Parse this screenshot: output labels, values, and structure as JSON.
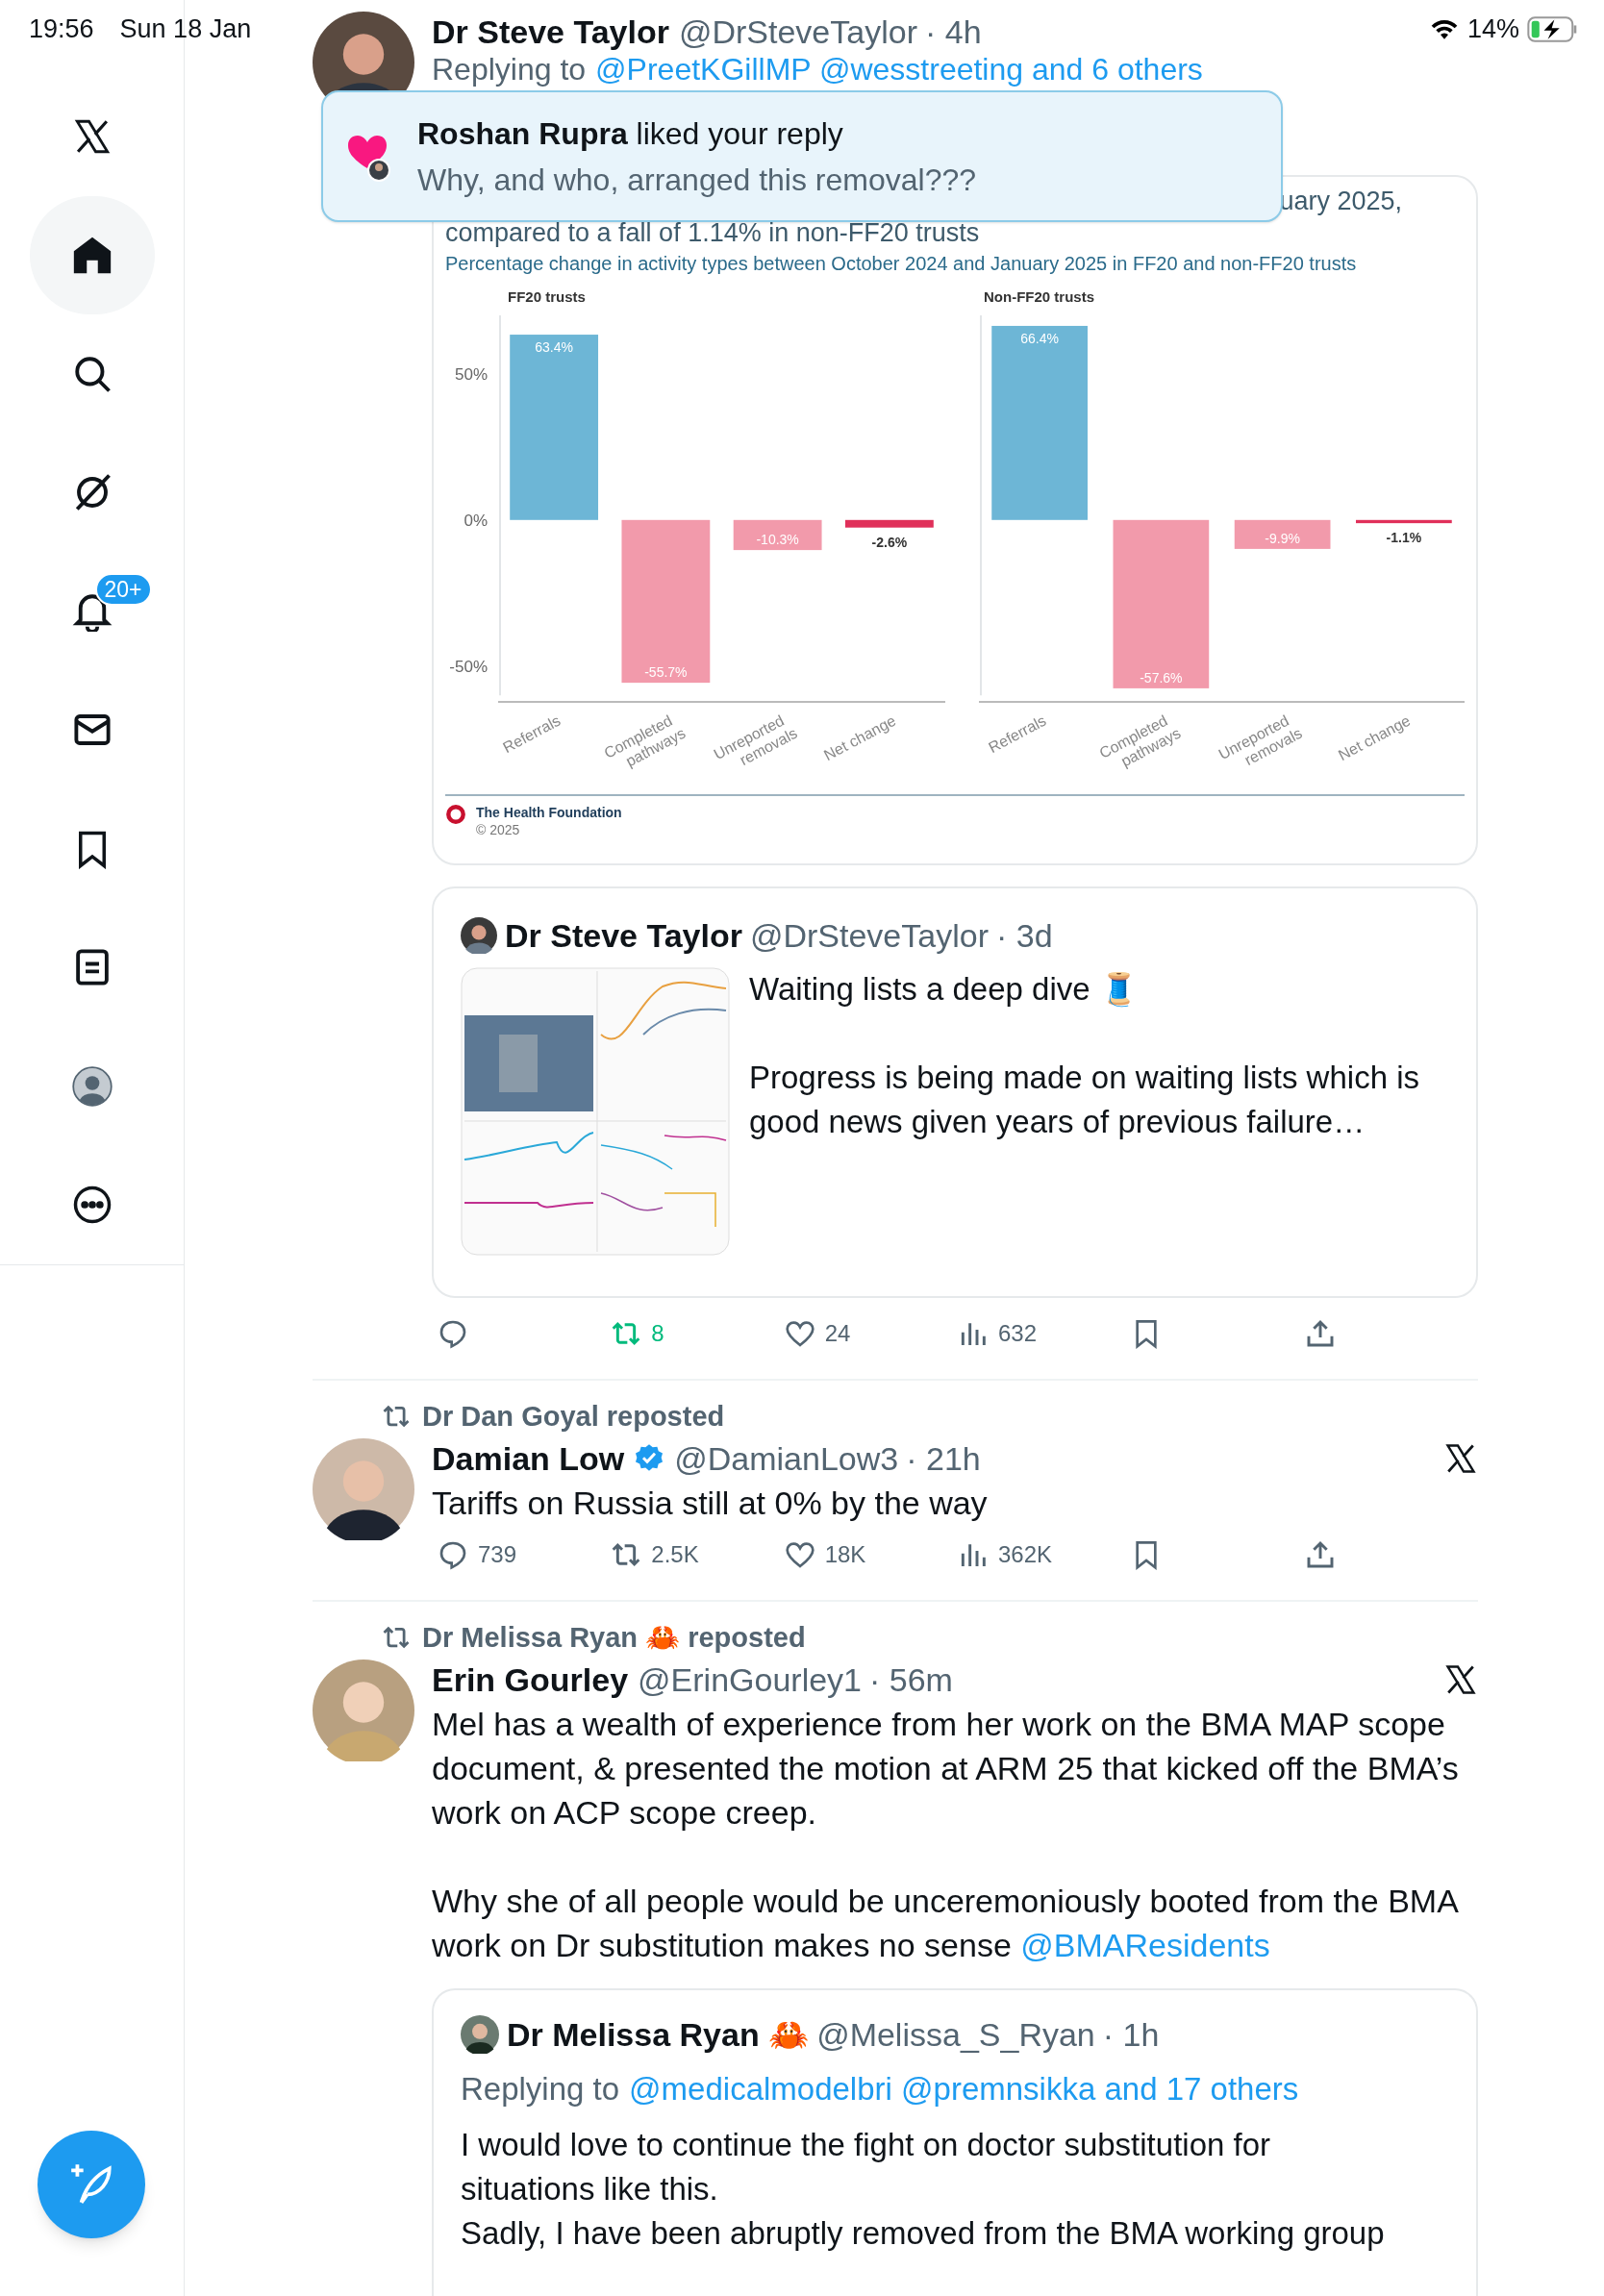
{
  "status_bar": {
    "time": "19:56",
    "date": "Sun 18 Jan",
    "battery": "14%"
  },
  "sidebar": {
    "items": [
      {
        "selected": false
      },
      {
        "selected": true
      },
      {
        "selected": false
      },
      {
        "selected": false
      },
      {
        "selected": false,
        "badge": "20+"
      },
      {
        "selected": false
      },
      {
        "selected": false
      },
      {
        "selected": false
      },
      {
        "selected": false
      },
      {
        "selected": false
      }
    ]
  },
  "notification": {
    "text": "**Roshan Rupra** liked your reply",
    "detail": "Why, and who, arranged this removal???"
  },
  "tweets": [
    {
      "author": "Dr Steve Taylor",
      "handle": "@DrSteveTaylor",
      "time": "· 4h",
      "replying_to": {
        "label": "Replying to",
        "targets": "@PreetKGillMP @wesstreeting and 6 others"
      },
      "chart_card": {
        "heading_fragment": "uary 2025,",
        "heading": "compared to a fall of 1.14% in non-FF20 trusts",
        "subtitle": "Percentage change in activity types between October 2024 and January 2025 in FF20 and non-FF20 trusts",
        "source": "The Health Foundation",
        "copyright": "© 2025",
        "charts": [
          {
            "chart_data": {
              "type": "bar",
              "title": "FF20 trusts",
              "categories": [
                "Referrals",
                "Completed pathways",
                "Unreported removals",
                "Net change"
              ],
              "values": [
                63.4,
                -55.7,
                -10.3,
                -2.6
              ],
              "colors": [
                "#6db6d6",
                "#f29aab",
                "#f29aab",
                "#e0305a"
              ],
              "ylim": [
                -60,
                70
              ],
              "yticks": [
                {
                  "value": 50,
                  "label": "50%"
                },
                {
                  "value": 0,
                  "label": "0%"
                },
                {
                  "value": -50,
                  "label": "-50%"
                }
              ],
              "value_labels": [
                "63.4%",
                "-55.7%",
                "-10.3%",
                "-2.6%"
              ]
            }
          },
          {
            "chart_data": {
              "type": "bar",
              "title": "Non-FF20 trusts",
              "categories": [
                "Referrals",
                "Completed pathways",
                "Unreported removals",
                "Net change"
              ],
              "values": [
                66.4,
                -57.6,
                -9.9,
                -1.1
              ],
              "colors": [
                "#6db6d6",
                "#f29aab",
                "#f29aab",
                "#e0305a"
              ],
              "ylim": [
                -60,
                70
              ],
              "value_labels": [
                "66.4%",
                "-57.6%",
                "-9.9%",
                "-1.1%"
              ]
            }
          }
        ]
      },
      "quote": {
        "author": "Dr Steve Taylor",
        "handle": "@DrSteveTaylor",
        "time": "· 3d",
        "paragraphs": [
          "Waiting lists a deep dive 🧵",
          "Progress is being made on waiting lists which is good news given years of previous failure…"
        ]
      },
      "actions": {
        "retweets": "8",
        "retweeted": true,
        "likes": "24",
        "views": "632"
      }
    },
    {
      "reposted_by": "Dr Dan Goyal reposted",
      "author": "Damian Low",
      "verified": true,
      "handle": "@DamianLow3",
      "time": "· 21h",
      "paragraphs": [
        [
          {
            "text": "Tariffs on Russia still at 0% by the way"
          }
        ]
      ],
      "actions": {
        "replies": "739",
        "retweets": "2.5K",
        "retweeted": false,
        "likes": "18K",
        "views": "362K"
      }
    },
    {
      "reposted_by": "Dr Melissa Ryan 🦀 reposted",
      "author": "Erin Gourley",
      "verified": false,
      "handle": "@ErinGourley1",
      "time": "· 56m",
      "paragraphs": [
        [
          {
            "text": "Mel has a wealth of experience from her work on the BMA MAP scope document, & presented the motion at ARM 25 that kicked off the BMA’s work on ACP scope creep."
          }
        ],
        [
          {
            "text": "Why she of all people would be unceremoniously booted from the BMA work on Dr substitution makes no sense "
          },
          {
            "link": "@BMAResidents"
          }
        ]
      ],
      "quote": {
        "author": "Dr Melissa Ryan 🦀",
        "handle": "@Melissa_S_Ryan",
        "time": "· 1h",
        "replying_to": {
          "label": "Replying to",
          "targets": "@medicalmodelbri @premnsikka and 17 others"
        },
        "lines": [
          "I would love to continue the fight on doctor substitution for situations like this.",
          "Sadly, I have been abruptly removed from the BMA working group"
        ]
      }
    }
  ]
}
